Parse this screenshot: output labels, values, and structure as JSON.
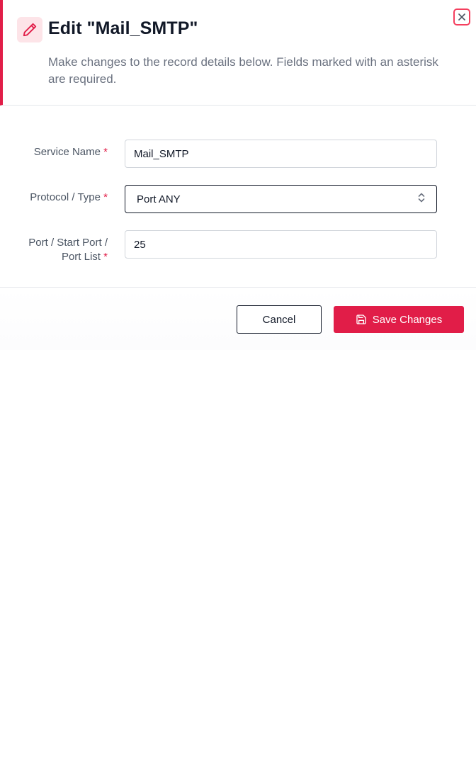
{
  "dialog": {
    "title": "Edit \"Mail_SMTP\"",
    "subtitle": "Make changes to the record details below. Fields marked with an asterisk are required.",
    "header_icon": "pencil-icon",
    "close_icon": "close-icon",
    "accent_color": "#e11d48"
  },
  "form": {
    "required_marker": "*",
    "service_name": {
      "label": "Service Name",
      "value": "Mail_SMTP"
    },
    "protocol_type": {
      "label": "Protocol / Type",
      "selected": "Port ANY",
      "icon": "chevron-up-down-icon"
    },
    "port": {
      "label_line1": "Port / Start Port /",
      "label_line2": "Port List",
      "value": "25"
    }
  },
  "footer": {
    "cancel_label": "Cancel",
    "save_label": "Save Changes",
    "save_icon": "save-icon"
  }
}
